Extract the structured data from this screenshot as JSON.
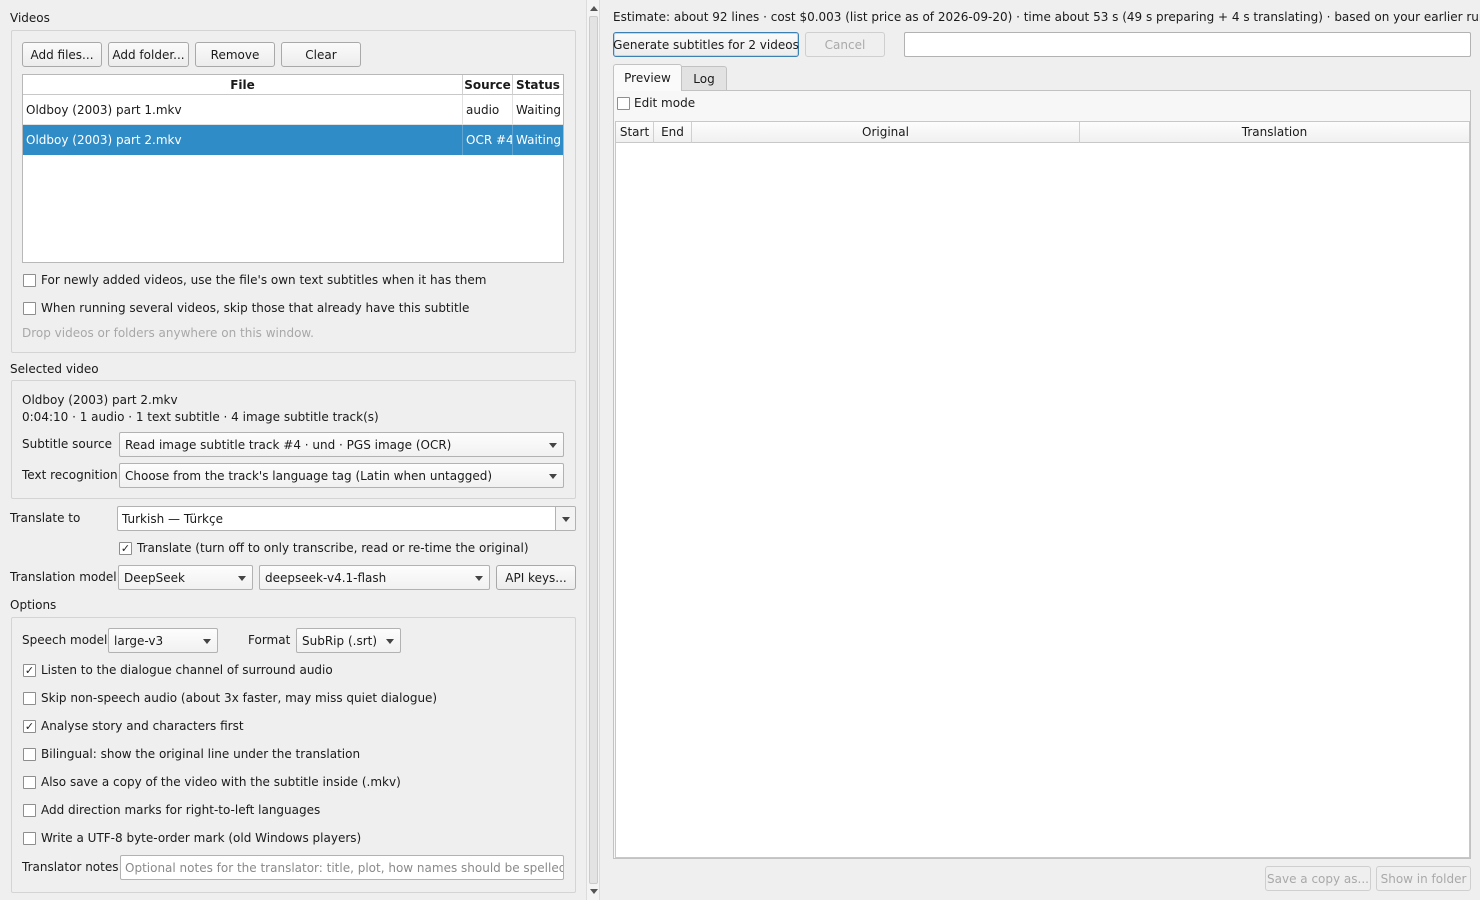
{
  "videos": {
    "title": "Videos",
    "add_files": "Add files...",
    "add_folder": "Add folder...",
    "remove": "Remove",
    "clear": "Clear",
    "columns": [
      "File",
      "Source",
      "Status"
    ],
    "rows": [
      {
        "file": "Oldboy (2003) part 1.mkv",
        "source": "audio",
        "status": "Waiting"
      },
      {
        "file": "Oldboy (2003) part 2.mkv",
        "source": "OCR #4",
        "status": "Waiting"
      }
    ],
    "selected_row": 1,
    "use_own_subs": "For newly added videos, use the file's own text subtitles when it has them",
    "skip_existing": "When running several videos, skip those that already have this subtitle",
    "drop_hint": "Drop videos or folders anywhere on this window."
  },
  "selected": {
    "title": "Selected video",
    "name": "Oldboy (2003) part 2.mkv",
    "info": "0:04:10 · 1 audio · 1 text subtitle · 4 image subtitle track(s)",
    "source_label": "Subtitle source",
    "source_value": "Read image subtitle track #4 · und · PGS image (OCR)",
    "ocr_label": "Text recognition",
    "ocr_value": "Choose from the track's language tag (Latin when untagged)"
  },
  "translate": {
    "label": "Translate to",
    "value": "Turkish — Türkçe",
    "toggle": "Translate (turn off to only transcribe, read or re-time the original)",
    "toggle_checked": true,
    "model_label": "Translation model",
    "provider": "DeepSeek",
    "model": "deepseek-v4.1-flash",
    "api_keys": "API keys..."
  },
  "options": {
    "title": "Options",
    "speech_label": "Speech model",
    "speech_value": "large-v3",
    "format_label": "Format",
    "format_value": "SubRip (.srt)",
    "checks": [
      {
        "label": "Listen to the dialogue channel of surround audio",
        "checked": true
      },
      {
        "label": "Skip non-speech audio (about 3x faster, may miss quiet dialogue)",
        "checked": false
      },
      {
        "label": "Analyse story and characters first",
        "checked": true
      },
      {
        "label": "Bilingual: show the original line under the translation",
        "checked": false
      },
      {
        "label": "Also save a copy of the video with the subtitle inside (.mkv)",
        "checked": false
      },
      {
        "label": "Add direction marks for right-to-left languages",
        "checked": false
      },
      {
        "label": "Write a UTF-8 byte-order mark (old Windows players)",
        "checked": false
      }
    ],
    "notes_label": "Translator notes",
    "notes_placeholder": "Optional notes for the translator: title, plot, how names should be spelled..."
  },
  "right": {
    "estimate": "Estimate: about 92 lines · cost $0.003 (list price as of 2026-09-20) · time about 53 s (49 s preparing + 4 s translating) · based on your earlier runs",
    "generate": "Generate subtitles for 2 videos",
    "cancel": "Cancel",
    "tabs": [
      "Preview",
      "Log"
    ],
    "active_tab": 0,
    "edit_mode": "Edit mode",
    "columns": [
      "Start",
      "End",
      "Original",
      "Translation"
    ],
    "save_copy": "Save a copy as...",
    "show_folder": "Show in folder"
  }
}
